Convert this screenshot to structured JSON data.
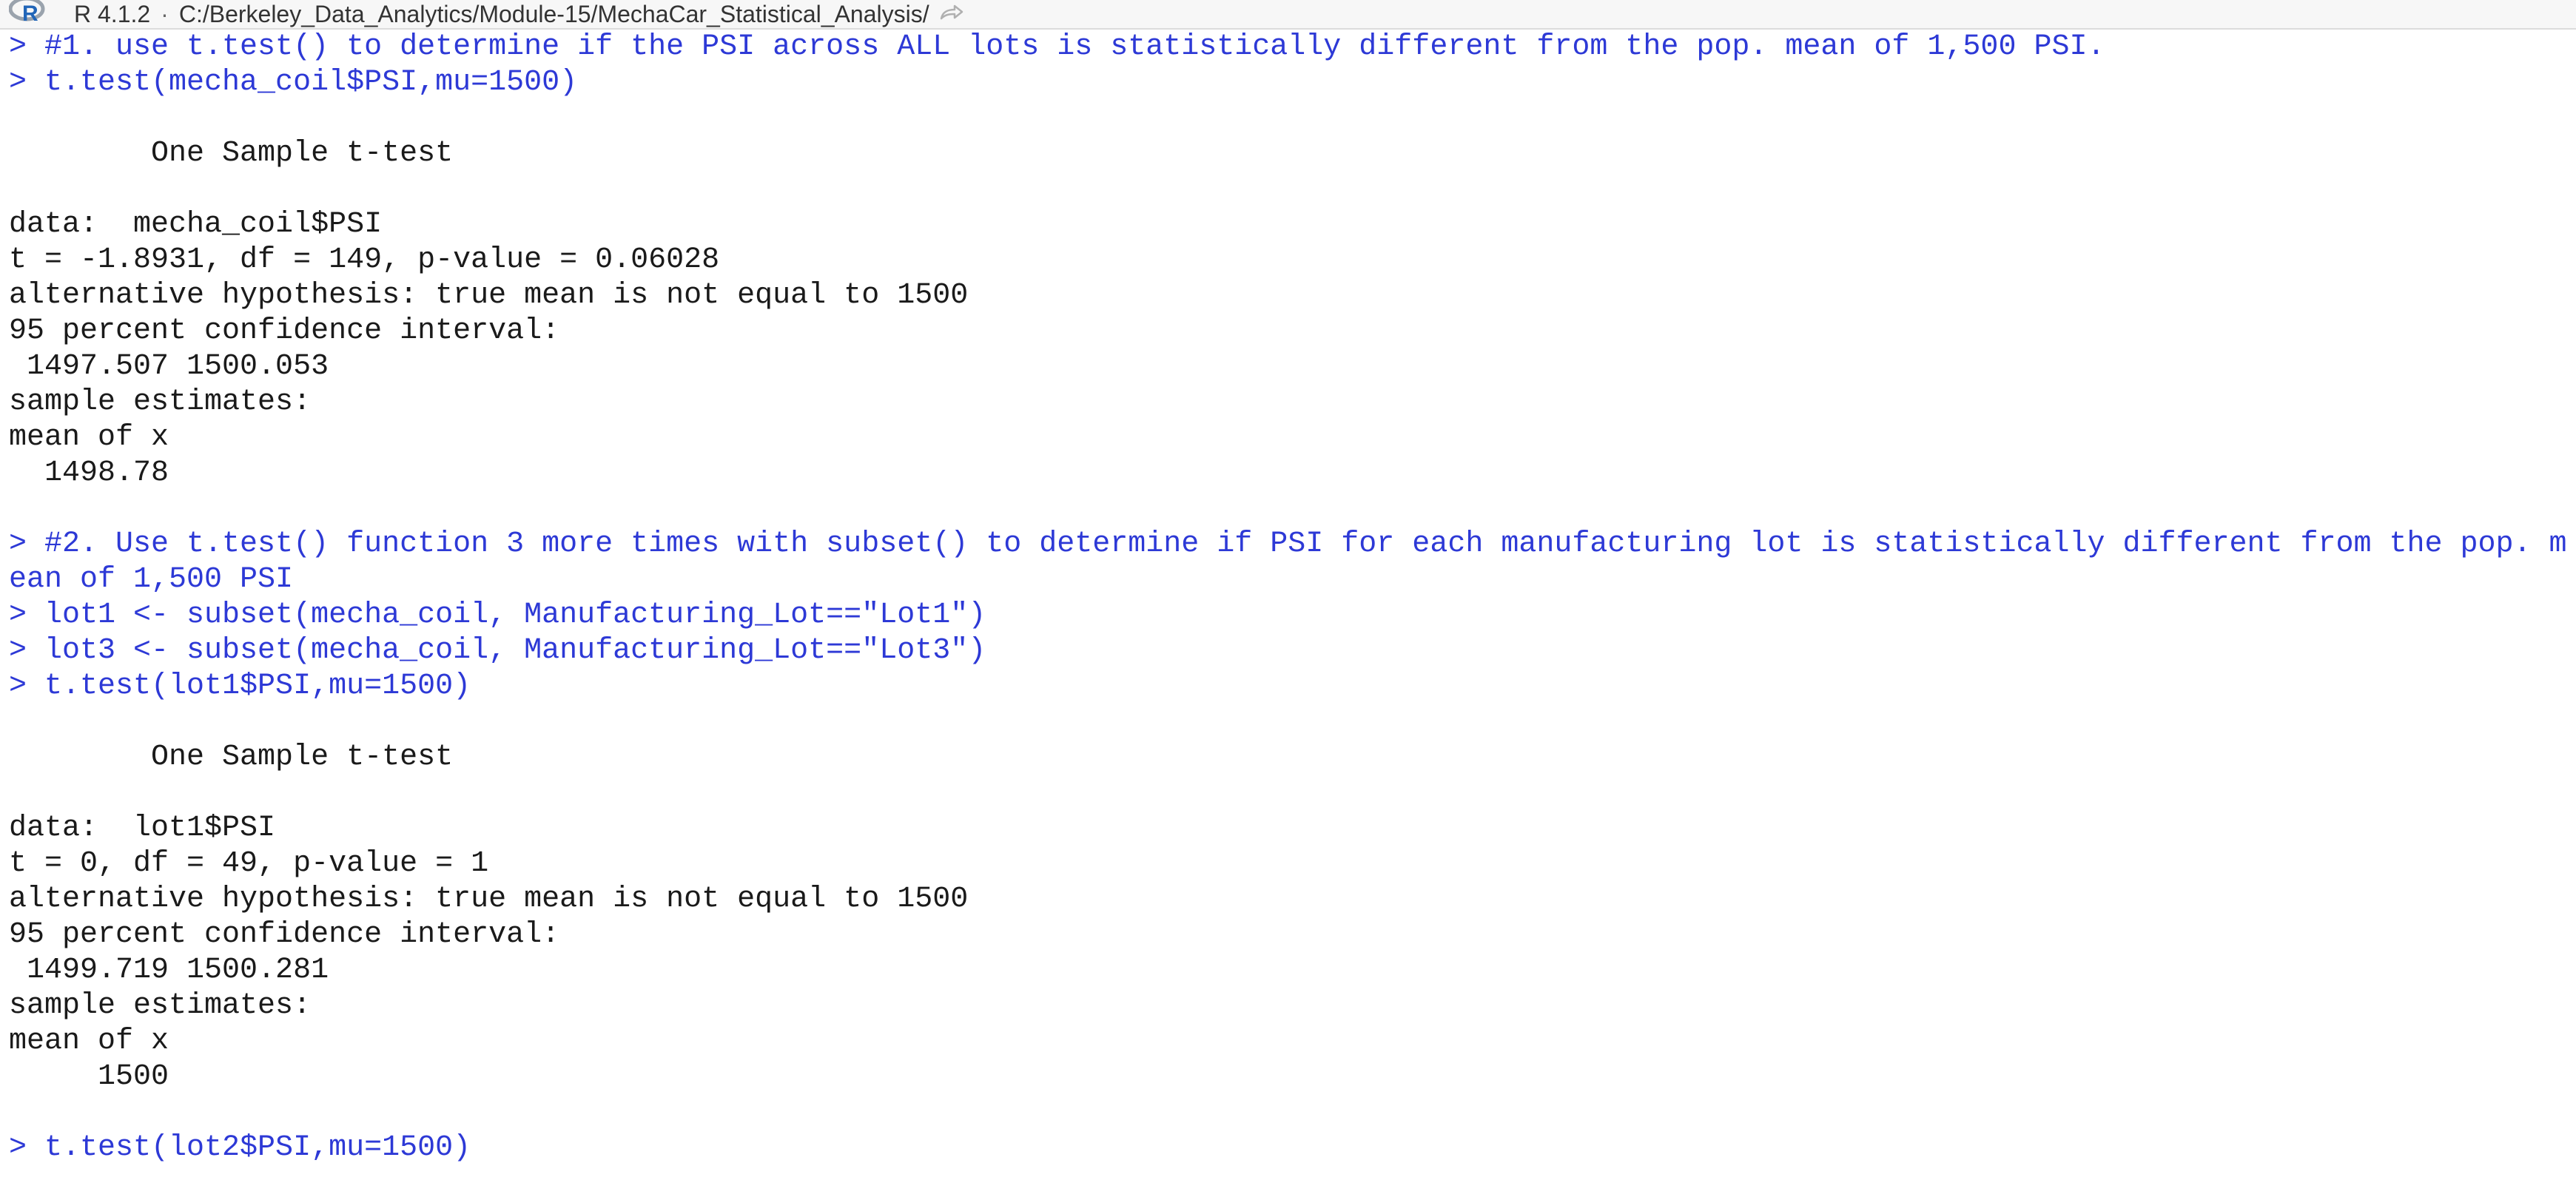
{
  "header": {
    "r_version": "R 4.1.2",
    "separator": "·",
    "working_directory": "C:/Berkeley_Data_Analytics/Module-15/MechaCar_Statistical_Analysis/",
    "icons": {
      "logo": "r-logo-icon",
      "go_to_directory": "share-arrow-icon"
    }
  },
  "colors": {
    "command_text": "#2d39d6",
    "output_text": "#1a1a1a",
    "header_bg": "#f7f7f7",
    "r_logo_ring": "#9aa3ad",
    "r_logo_letter": "#2266b8"
  },
  "console": {
    "lines": [
      {
        "type": "command",
        "text": "> #1. use t.test() to determine if the PSI across ALL lots is statistically different from the pop. mean of 1,500 PSI."
      },
      {
        "type": "command",
        "text": "> t.test(mecha_coil$PSI,mu=1500)"
      },
      {
        "type": "output",
        "text": ""
      },
      {
        "type": "output",
        "text": "        One Sample t-test"
      },
      {
        "type": "output",
        "text": ""
      },
      {
        "type": "output",
        "text": "data:  mecha_coil$PSI"
      },
      {
        "type": "output",
        "text": "t = -1.8931, df = 149, p-value = 0.06028"
      },
      {
        "type": "output",
        "text": "alternative hypothesis: true mean is not equal to 1500"
      },
      {
        "type": "output",
        "text": "95 percent confidence interval:"
      },
      {
        "type": "output",
        "text": " 1497.507 1500.053"
      },
      {
        "type": "output",
        "text": "sample estimates:"
      },
      {
        "type": "output",
        "text": "mean of x"
      },
      {
        "type": "output",
        "text": "  1498.78"
      },
      {
        "type": "output",
        "text": ""
      },
      {
        "type": "command",
        "text": "> #2. Use t.test() function 3 more times with subset() to determine if PSI for each manufacturing lot is statistically different from the pop. m"
      },
      {
        "type": "command",
        "text": "ean of 1,500 PSI"
      },
      {
        "type": "command",
        "text": "> lot1 <- subset(mecha_coil, Manufacturing_Lot==\"Lot1\")"
      },
      {
        "type": "command",
        "text": "> lot3 <- subset(mecha_coil, Manufacturing_Lot==\"Lot3\")"
      },
      {
        "type": "command",
        "text": "> t.test(lot1$PSI,mu=1500)"
      },
      {
        "type": "output",
        "text": ""
      },
      {
        "type": "output",
        "text": "        One Sample t-test"
      },
      {
        "type": "output",
        "text": ""
      },
      {
        "type": "output",
        "text": "data:  lot1$PSI"
      },
      {
        "type": "output",
        "text": "t = 0, df = 49, p-value = 1"
      },
      {
        "type": "output",
        "text": "alternative hypothesis: true mean is not equal to 1500"
      },
      {
        "type": "output",
        "text": "95 percent confidence interval:"
      },
      {
        "type": "output",
        "text": " 1499.719 1500.281"
      },
      {
        "type": "output",
        "text": "sample estimates:"
      },
      {
        "type": "output",
        "text": "mean of x"
      },
      {
        "type": "output",
        "text": "     1500"
      },
      {
        "type": "output",
        "text": ""
      },
      {
        "type": "command",
        "text": "> t.test(lot2$PSI,mu=1500)"
      }
    ]
  }
}
